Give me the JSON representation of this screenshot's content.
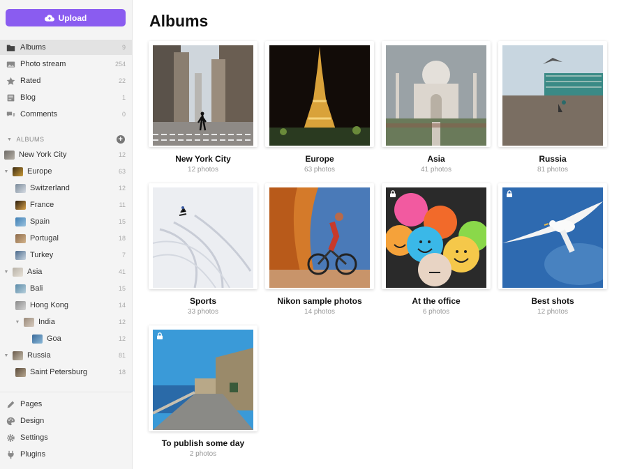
{
  "sidebar": {
    "upload_label": "Upload",
    "nav": [
      {
        "label": "Albums",
        "count": "9",
        "icon": "folder-icon",
        "active": true
      },
      {
        "label": "Photo stream",
        "count": "254",
        "icon": "photo-stream-icon"
      },
      {
        "label": "Rated",
        "count": "22",
        "icon": "star-icon"
      },
      {
        "label": "Blog",
        "count": "1",
        "icon": "blog-icon"
      },
      {
        "label": "Comments",
        "count": "0",
        "icon": "comments-icon"
      }
    ],
    "albums_heading": "ALBUMS",
    "tree": [
      {
        "label": "New York City",
        "count": "12"
      },
      {
        "label": "Europe",
        "count": "63"
      },
      {
        "label": "Switzerland",
        "count": "12"
      },
      {
        "label": "France",
        "count": "11"
      },
      {
        "label": "Spain",
        "count": "15"
      },
      {
        "label": "Portugal",
        "count": "18"
      },
      {
        "label": "Turkey",
        "count": "7"
      },
      {
        "label": "Asia",
        "count": "41"
      },
      {
        "label": "Bali",
        "count": "15"
      },
      {
        "label": "Hong Kong",
        "count": "14"
      },
      {
        "label": "India",
        "count": "12"
      },
      {
        "label": "Goa",
        "count": "12"
      },
      {
        "label": "Russia",
        "count": "81"
      },
      {
        "label": "Saint Petersburg",
        "count": "18"
      }
    ],
    "bottom": [
      {
        "label": "Pages",
        "icon": "pencil-icon"
      },
      {
        "label": "Design",
        "icon": "palette-icon"
      },
      {
        "label": "Settings",
        "icon": "gear-icon"
      },
      {
        "label": "Plugins",
        "icon": "plug-icon"
      }
    ]
  },
  "main": {
    "title": "Albums",
    "albums": [
      {
        "name": "New York City",
        "sub": "12 photos",
        "locked": false
      },
      {
        "name": "Europe",
        "sub": "63 photos",
        "locked": false
      },
      {
        "name": "Asia",
        "sub": "41 photos",
        "locked": false
      },
      {
        "name": "Russia",
        "sub": "81 photos",
        "locked": false
      },
      {
        "name": "Sports",
        "sub": "33 photos",
        "locked": false
      },
      {
        "name": "Nikon sample photos",
        "sub": "14 photos",
        "locked": false
      },
      {
        "name": "At the office",
        "sub": "6 photos",
        "locked": true
      },
      {
        "name": "Best shots",
        "sub": "12 photos",
        "locked": true
      },
      {
        "name": "To publish some day",
        "sub": "2 photos",
        "locked": true
      }
    ]
  },
  "colors": {
    "accent": "#8a5cf0",
    "sidebar_bg": "#f4f4f4",
    "active_row": "#e3e3e3"
  }
}
